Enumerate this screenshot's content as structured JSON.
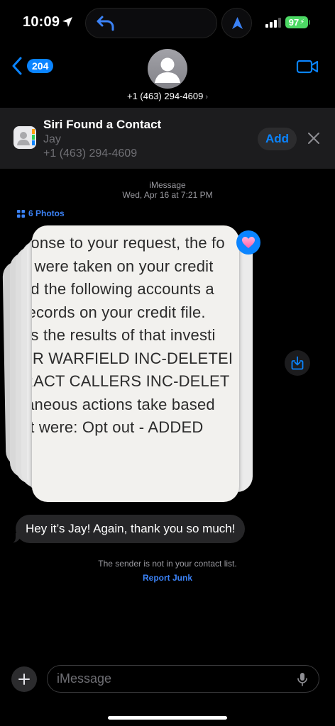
{
  "status_bar": {
    "time": "10:09",
    "battery": "97"
  },
  "header": {
    "unread_count": "204",
    "contact_number": "+1 (463) 294-4609",
    "chevron": "›"
  },
  "siri_banner": {
    "title": "Siri Found a Contact",
    "name": "Jay",
    "phone": "+1 (463) 294-4609",
    "add_label": "Add"
  },
  "conversation": {
    "service": "iMessage",
    "timestamp": "Wed, Apr 16 at 7:21 PM",
    "photos_label": "6 Photos",
    "photo_text_lines": [
      "ponse to your request, the fo",
      "s were taken on your credit",
      "ed the following accounts a",
      "records on your credit file.",
      "es the results of that investi",
      "ER WARFIELD INC-DELETEI",
      "RACT CALLERS INC-DELET",
      "laneous actions take based",
      "st were: Opt out - ADDED"
    ],
    "message": "Hey it’s Jay! Again, thank you so much!",
    "notice": "The sender is not in your contact list.",
    "report_junk": "Report Junk"
  },
  "input": {
    "placeholder": "iMessage"
  },
  "colors": {
    "accent": "#0a84ff",
    "battery": "#4cd964",
    "banner_bg": "#1c1c1e",
    "bubble_bg": "#262628"
  },
  "icons": [
    "location-arrow-icon",
    "reply-arrow-icon",
    "navigation-icon",
    "signal-icon",
    "back-chevron-icon",
    "person-icon",
    "video-camera-icon",
    "contacts-app-icon",
    "close-icon",
    "photo-grid-icon",
    "heart-icon",
    "save-download-icon",
    "plus-icon",
    "microphone-icon"
  ]
}
